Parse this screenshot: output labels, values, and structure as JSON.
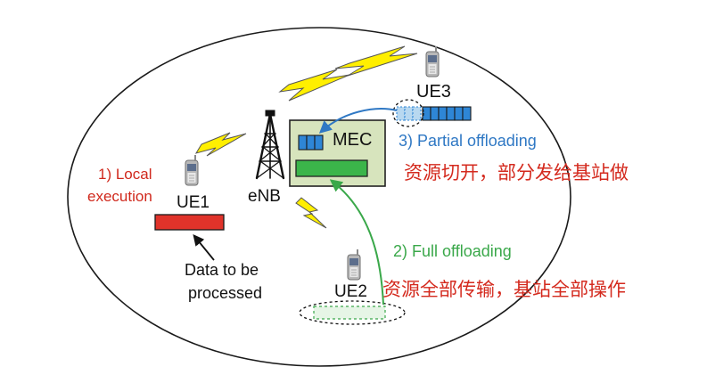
{
  "labels": {
    "ue1": "UE1",
    "ue2": "UE2",
    "ue3": "UE3",
    "enb": "eNB",
    "mec": "MEC",
    "local_line1": "1) Local",
    "local_line2": "execution",
    "partial": "3) Partial offloading",
    "full": "2) Full offloading",
    "data_line1": "Data to be",
    "data_line2": "processed"
  },
  "annotations": {
    "partial_note": "资源切开，部分发给基站做",
    "full_note": "资源全部传输，基站全部操作"
  },
  "colors": {
    "local_red": "#d0281c",
    "task_red": "#e0332a",
    "partial_blue": "#2f78c4",
    "task_blue": "#2e86d6",
    "full_green": "#3aa84a",
    "mec_fill": "#d7e4bd",
    "note_red": "#d42a1e",
    "bolt_yellow": "#ffef00"
  },
  "icons": [
    "phone-icon",
    "tower-icon",
    "lightning-icon"
  ]
}
